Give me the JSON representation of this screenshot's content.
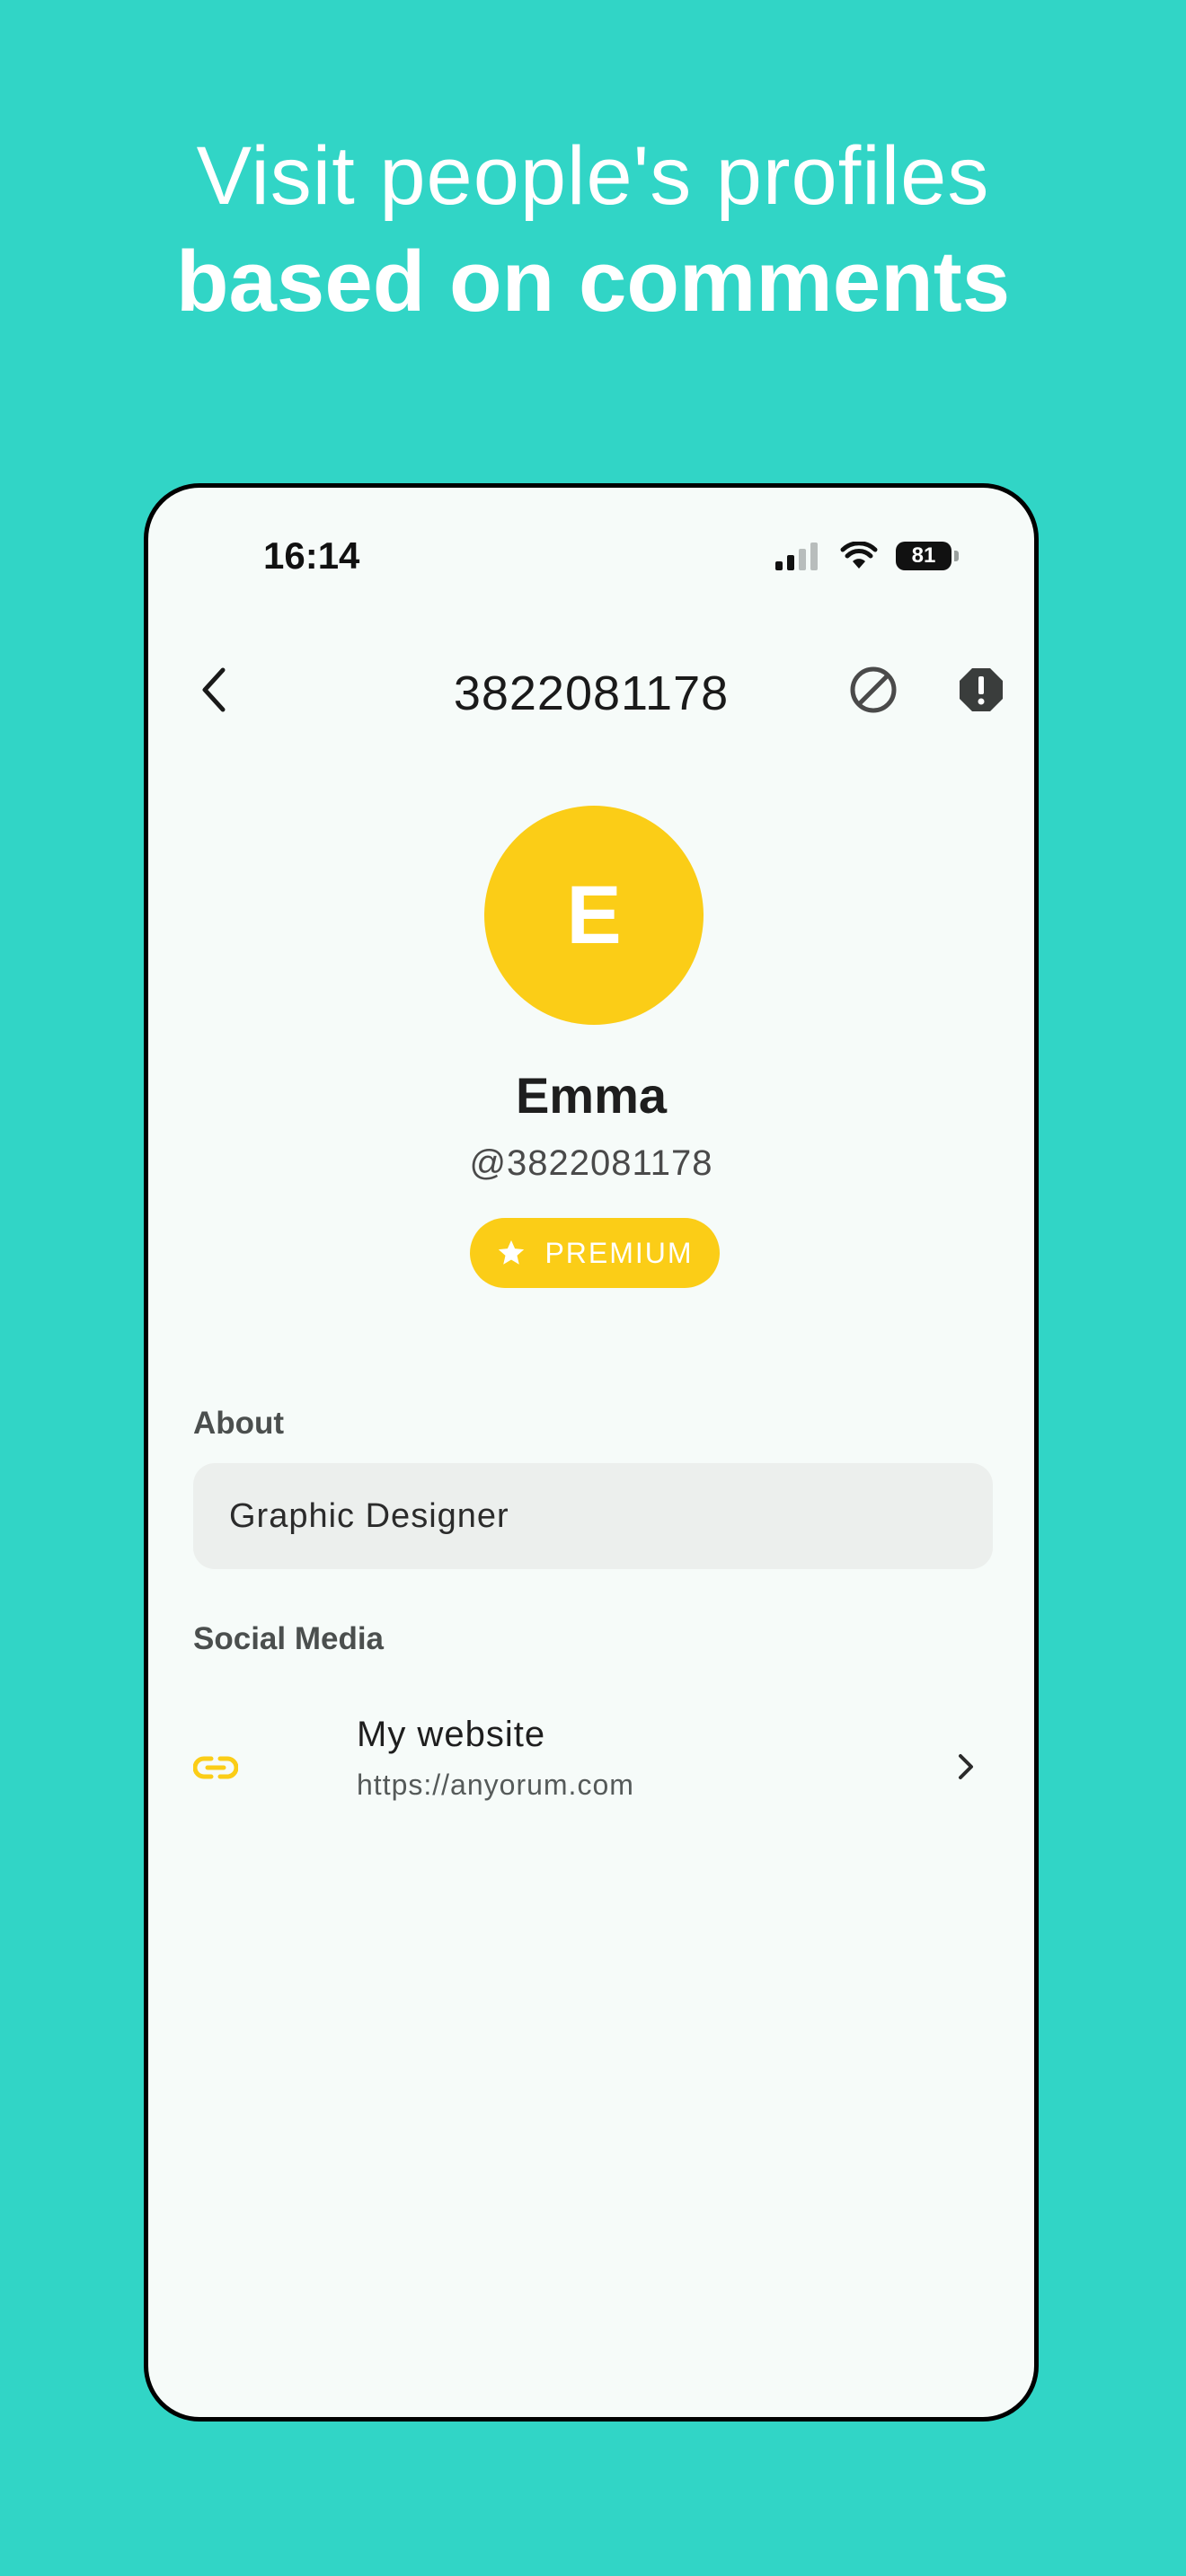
{
  "headline": {
    "line1": "Visit people's profiles",
    "line2": "based on comments"
  },
  "status_bar": {
    "time": "16:14",
    "battery": "81"
  },
  "nav": {
    "title": "3822081178"
  },
  "profile": {
    "avatar_initial": "E",
    "name": "Emma",
    "handle": "@3822081178",
    "badge": "PREMIUM"
  },
  "about": {
    "label": "About",
    "value": "Graphic Designer"
  },
  "social": {
    "label": "Social Media",
    "items": [
      {
        "title": "My website",
        "url": "https://anyorum.com",
        "icon": "link-icon"
      }
    ]
  },
  "colors": {
    "background": "#31D5C6",
    "accent": "#FBCD17",
    "screen": "#F6FBF9",
    "field": "#ECEFED"
  }
}
